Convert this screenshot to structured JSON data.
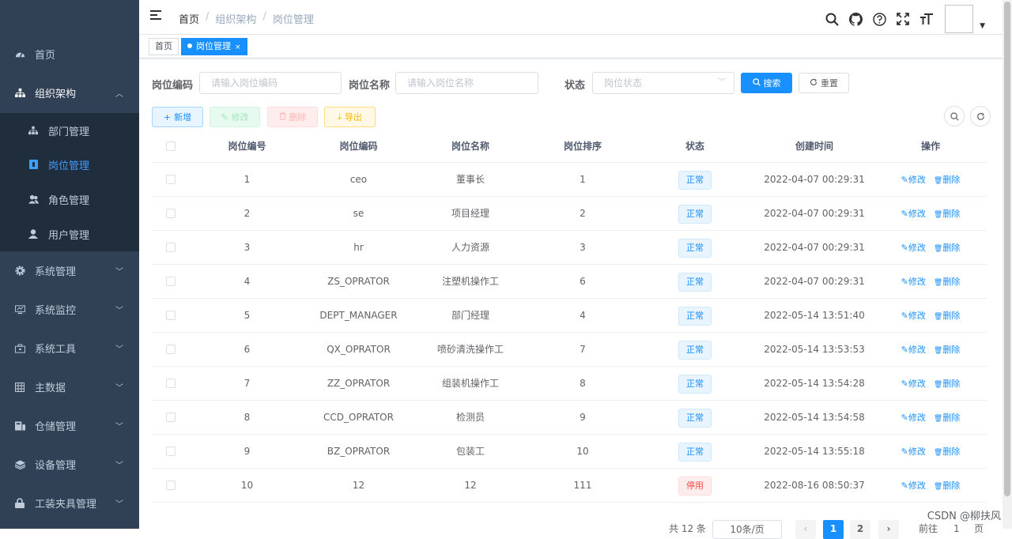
{
  "sidebar": {
    "items": [
      {
        "label": "首页",
        "icon": "dashboard-icon"
      },
      {
        "label": "组织架构",
        "icon": "tree-icon"
      },
      {
        "label": "系统管理",
        "icon": "gear-icon"
      },
      {
        "label": "系统监控",
        "icon": "monitor-icon"
      },
      {
        "label": "系统工具",
        "icon": "toolbox-icon"
      },
      {
        "label": "主数据",
        "icon": "grid-icon"
      },
      {
        "label": "仓储管理",
        "icon": "warehouse-icon"
      },
      {
        "label": "设备管理",
        "icon": "layers-icon"
      },
      {
        "label": "工装夹具管理",
        "icon": "lock-icon"
      }
    ],
    "subitems": [
      {
        "label": "部门管理",
        "icon": "tree-icon"
      },
      {
        "label": "岗位管理",
        "icon": "post-icon"
      },
      {
        "label": "角色管理",
        "icon": "peoples-icon"
      },
      {
        "label": "用户管理",
        "icon": "user-icon"
      }
    ]
  },
  "header": {
    "breadcrumb": [
      "首页",
      "组织架构",
      "岗位管理"
    ],
    "tools": [
      "search-icon",
      "github-icon",
      "question-icon",
      "fullscreen-icon",
      "font-size-icon"
    ]
  },
  "tags": {
    "home": "首页",
    "active": "岗位管理",
    "close": "×"
  },
  "search": {
    "code_label": "岗位编码",
    "code_placeholder": "请输入岗位编码",
    "name_label": "岗位名称",
    "name_placeholder": "请输入岗位名称",
    "status_label": "状态",
    "status_placeholder": "岗位状态",
    "search_button": "搜索",
    "reset_button": "重置"
  },
  "toolbar": {
    "add": "新增",
    "edit": "修改",
    "delete": "删除",
    "export": "导出"
  },
  "table": {
    "headers": [
      "岗位编号",
      "岗位编码",
      "岗位名称",
      "岗位排序",
      "状态",
      "创建时间",
      "操作"
    ],
    "edit_label": "修改",
    "delete_label": "删除",
    "rows": [
      {
        "id": "1",
        "code": "ceo",
        "name": "董事长",
        "sort": "1",
        "status": "正常",
        "time": "2022-04-07 00:29:31"
      },
      {
        "id": "2",
        "code": "se",
        "name": "项目经理",
        "sort": "2",
        "status": "正常",
        "time": "2022-04-07 00:29:31"
      },
      {
        "id": "3",
        "code": "hr",
        "name": "人力资源",
        "sort": "3",
        "status": "正常",
        "time": "2022-04-07 00:29:31"
      },
      {
        "id": "4",
        "code": "ZS_OPRATOR",
        "name": "注塑机操作工",
        "sort": "6",
        "status": "正常",
        "time": "2022-04-07 00:29:31"
      },
      {
        "id": "5",
        "code": "DEPT_MANAGER",
        "name": "部门经理",
        "sort": "4",
        "status": "正常",
        "time": "2022-05-14 13:51:40"
      },
      {
        "id": "6",
        "code": "QX_OPRATOR",
        "name": "喷砂清洗操作工",
        "sort": "7",
        "status": "正常",
        "time": "2022-05-14 13:53:53"
      },
      {
        "id": "7",
        "code": "ZZ_OPRATOR",
        "name": "组装机操作工",
        "sort": "8",
        "status": "正常",
        "time": "2022-05-14 13:54:28"
      },
      {
        "id": "8",
        "code": "CCD_OPRATOR",
        "name": "检测员",
        "sort": "9",
        "status": "正常",
        "time": "2022-05-14 13:54:58"
      },
      {
        "id": "9",
        "code": "BZ_OPRATOR",
        "name": "包装工",
        "sort": "10",
        "status": "正常",
        "time": "2022-05-14 13:55:18"
      },
      {
        "id": "10",
        "code": "12",
        "name": "12",
        "sort": "111",
        "status": "停用",
        "time": "2022-08-16 08:50:37"
      }
    ]
  },
  "pagination": {
    "total": "共 12 条",
    "page_size": "10条/页",
    "pages": [
      "1",
      "2"
    ],
    "goto": "前往",
    "goto_value": "1",
    "page_unit": "页"
  },
  "watermark": "CSDN @柳扶风",
  "colors": {
    "sidebar_bg": "#304156",
    "submenu_bg": "#1f2d3d",
    "accent": "#1890ff",
    "danger": "#ff4949"
  }
}
